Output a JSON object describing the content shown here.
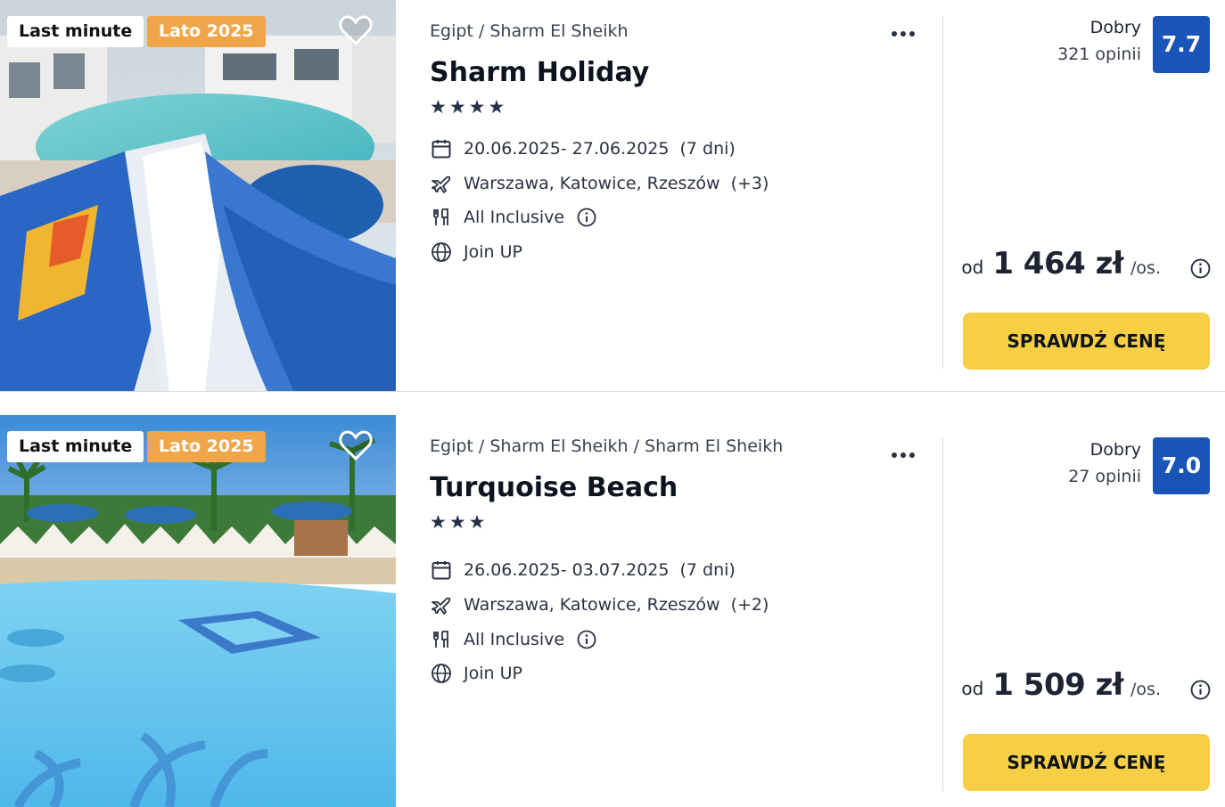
{
  "colors": {
    "score_bg": "#1b54b8",
    "cta_bg": "#f6cf45",
    "season_badge": "#f0a648"
  },
  "offers": [
    {
      "badges": {
        "last_minute": "Last minute",
        "season": "Lato 2025"
      },
      "breadcrumb": "Egipt / Sharm El Sheikh",
      "name": "Sharm Holiday",
      "stars": 4,
      "dates": "20.06.2025- 27.06.2025",
      "duration": "(7 dni)",
      "departures": "Warszawa, Katowice, Rzeszów",
      "departures_more": "(+3)",
      "board": "All Inclusive",
      "operator": "Join UP",
      "rating_label": "Dobry",
      "rating_count": "321 opinii",
      "score": "7.7",
      "price_prefix": "od",
      "price": "1 464 zł",
      "price_suffix": "/os.",
      "cta": "SPRAWDŹ CENĘ",
      "icons": [
        "heart-icon",
        "more-icon",
        "calendar-icon",
        "plane-icon",
        "utensils-icon",
        "info-icon",
        "globe-icon"
      ]
    },
    {
      "badges": {
        "last_minute": "Last minute",
        "season": "Lato 2025"
      },
      "breadcrumb": "Egipt / Sharm El Sheikh / Sharm El Sheikh",
      "name": "Turquoise Beach",
      "stars": 3,
      "dates": "26.06.2025- 03.07.2025",
      "duration": "(7 dni)",
      "departures": "Warszawa, Katowice, Rzeszów",
      "departures_more": "(+2)",
      "board": "All Inclusive",
      "operator": "Join UP",
      "rating_label": "Dobry",
      "rating_count": "27 opinii",
      "score": "7.0",
      "price_prefix": "od",
      "price": "1 509 zł",
      "price_suffix": "/os.",
      "cta": "SPRAWDŹ CENĘ",
      "icons": [
        "heart-icon",
        "more-icon",
        "calendar-icon",
        "plane-icon",
        "utensils-icon",
        "info-icon",
        "globe-icon"
      ]
    }
  ]
}
